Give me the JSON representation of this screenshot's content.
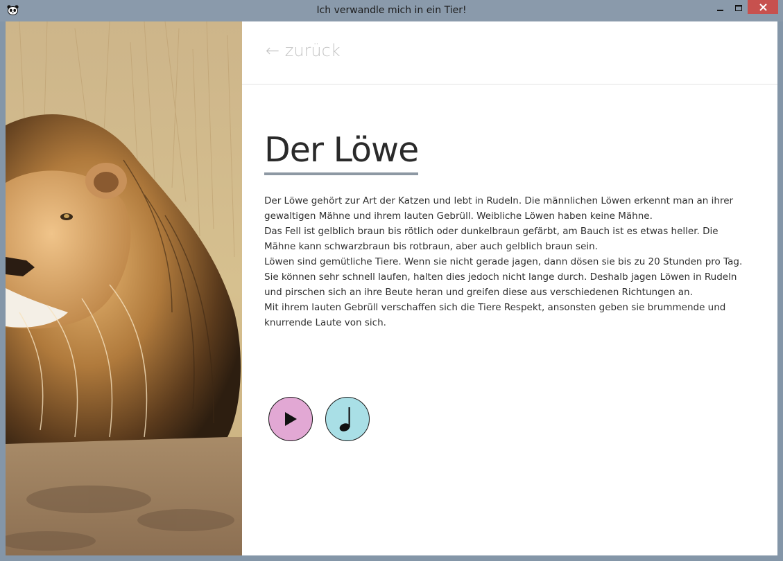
{
  "window": {
    "title": "Ich verwandle mich in ein Tier!",
    "title_bar_color": "#8a9aab",
    "close_button_color": "#c7514e"
  },
  "nav": {
    "back_label": "← zurück"
  },
  "animal": {
    "image_icon": "lion-photo",
    "name": "Der Löwe",
    "paragraphs": [
      "Der Löwe gehört zur Art der Katzen und lebt in Rudeln. Die männlichen Löwen erkennt man an ihrer gewaltigen Mähne und ihrem lauten Gebrüll. Weibliche Löwen haben keine Mähne.",
      "Das Fell ist gelblich braun bis rötlich oder dunkelbraun gefärbt, am Bauch ist es etwas heller. Die Mähne kann schwarzbraun bis rotbraun, aber auch gelblich braun sein.",
      "Löwen sind gemütliche Tiere. Wenn sie nicht gerade jagen, dann dösen sie bis zu 20 Stunden pro Tag. Sie können sehr schnell laufen, halten dies jedoch nicht lange durch. Deshalb jagen Löwen in Rudeln und pirschen sich an ihre Beute heran und greifen diese aus verschiedenen Richtungen an.",
      "Mit ihrem lauten Gebrüll verschaffen sich die Tiere Respekt, ansonsten geben sie brummende und knurrende Laute von sich."
    ]
  },
  "controls": {
    "play_icon": "play-icon",
    "play_color": "#e2a8d4",
    "sound_icon": "music-note-icon",
    "sound_color": "#a9dfe6"
  }
}
